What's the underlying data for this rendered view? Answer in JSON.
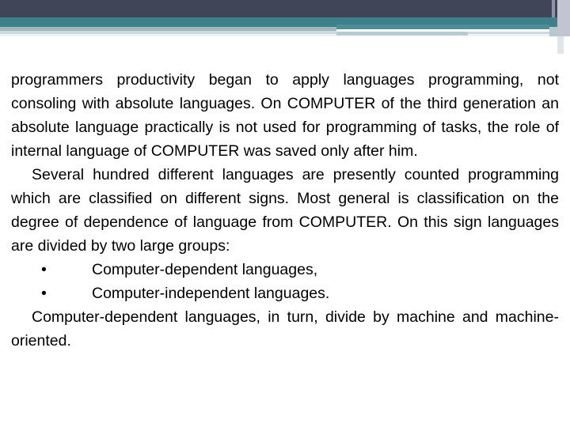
{
  "slide": {
    "background_color": "#ffffff",
    "decor": {
      "band_dark_color": "#414558",
      "band_teal_color": "#3d8089",
      "band_soft_color": "#9fb7bf",
      "rule_primary_color": "#4d8d96",
      "rule_secondary_color": "#b9ccd2",
      "stripe_lavender_color": "#c3c4d2"
    },
    "body": {
      "paragraph_1": "programmers productivity began to apply languages programming, not consoling with absolute languages. On COMPUTER of the third generation an absolute language practically is not used for programming of tasks, the role of internal language of COMPUTER was saved only after him.",
      "paragraph_2": "Several hundred different languages are presently counted programming which are classified on different signs. Most general is classification on the degree of dependence of language from COMPUTER. On this sign languages are divided by two large groups:",
      "bullets": [
        {
          "marker": "•",
          "text": "Computer-dependent languages,"
        },
        {
          "marker": "•",
          "text": "Computer-independent languages."
        }
      ],
      "paragraph_3": "Computer-dependent languages, in turn, divide by machine and machine-oriented."
    }
  }
}
